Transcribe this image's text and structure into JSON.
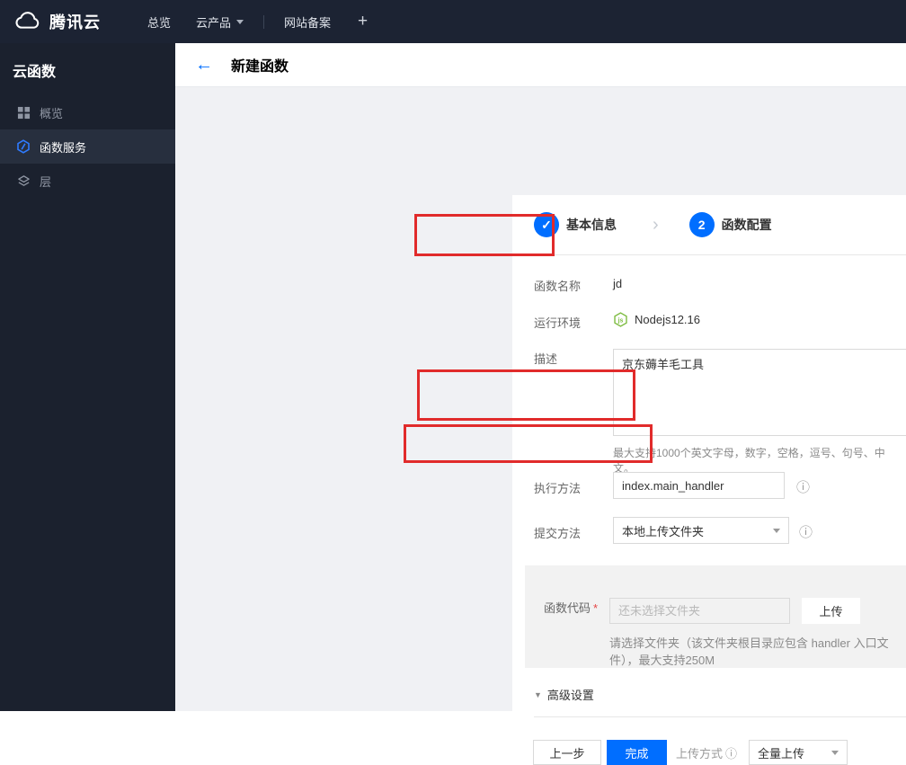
{
  "colors": {
    "accent": "#006eff",
    "annotation_red": "#e12b2b",
    "node_green": "#7cbb3f",
    "topbar_bg": "#1c2333",
    "sidebar_bg": "#1b212e"
  },
  "icons": {
    "back_arrow": "←",
    "info": "ⓘ",
    "check": "✓",
    "step_separator": "›",
    "plus": "+",
    "advanced_caret": "▼"
  },
  "topbar": {
    "brand": "腾讯云",
    "nav_overview": "总览",
    "nav_products": "云产品",
    "nav_icp": "网站备案"
  },
  "sidebar": {
    "title": "云函数",
    "items": [
      {
        "label": "概览"
      },
      {
        "label": "函数服务"
      },
      {
        "label": "层"
      }
    ]
  },
  "page_header": {
    "title": "新建函数"
  },
  "steps": {
    "step1_label": "基本信息",
    "step2_number": "2",
    "step2_label": "函数配置"
  },
  "form": {
    "name_label": "函数名称",
    "name_value": "jd",
    "runtime_label": "运行环境",
    "runtime_value": "Nodejs12.16",
    "runtime_icon_text": "js",
    "desc_label": "描述",
    "desc_value": "京东薅羊毛工具",
    "desc_hint": "最大支持1000个英文字母，数字，空格，逗号、句号、中文。",
    "handler_label": "执行方法",
    "handler_value": "index.main_handler",
    "submit_label": "提交方法",
    "submit_value": "本地上传文件夹",
    "code_label": "函数代码",
    "code_required": "*",
    "code_placeholder": "还未选择文件夹",
    "upload_button": "上传",
    "code_hint": "请选择文件夹（该文件夹根目录应包含 handler 入口文件），最大支持250M",
    "advanced_label": "高级设置"
  },
  "footer": {
    "prev": "上一步",
    "done": "完成",
    "upload_mode_label": "上传方式",
    "upload_mode_value": "全量上传"
  }
}
